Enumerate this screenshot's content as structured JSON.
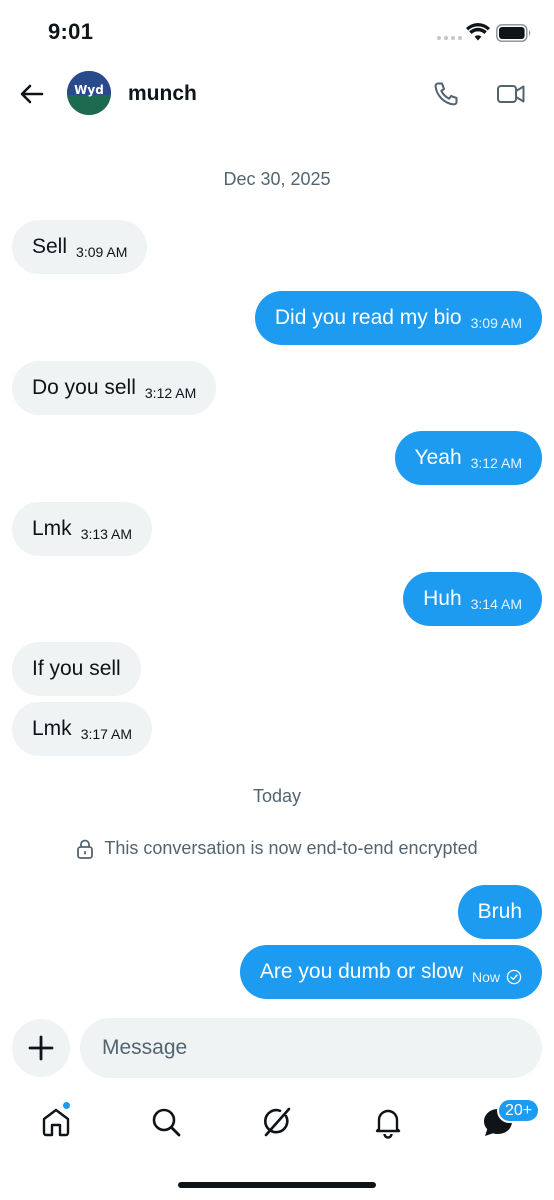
{
  "status_bar": {
    "time": "9:01"
  },
  "header": {
    "contact_name": "munch",
    "avatar_text": "Wyd"
  },
  "conversation": {
    "date_separator_1": "Dec 30, 2025",
    "date_separator_2": "Today",
    "encryption_notice": "This conversation is now end-to-end encrypted",
    "messages": [
      {
        "direction": "in",
        "text": "Sell",
        "time": "3:09 AM"
      },
      {
        "direction": "out",
        "text": "Did you read my bio",
        "time": "3:09 AM"
      },
      {
        "direction": "in",
        "text": "Do you sell",
        "time": "3:12 AM"
      },
      {
        "direction": "out",
        "text": "Yeah",
        "time": "3:12 AM"
      },
      {
        "direction": "in",
        "text": "Lmk",
        "time": "3:13 AM"
      },
      {
        "direction": "out",
        "text": "Huh",
        "time": "3:14 AM"
      },
      {
        "direction": "in",
        "text": "If you sell",
        "time": ""
      },
      {
        "direction": "in",
        "text": "Lmk",
        "time": "3:17 AM"
      },
      {
        "direction": "out",
        "text": "Bruh",
        "time": ""
      },
      {
        "direction": "out",
        "text": "Are you dumb or slow",
        "time": "Now",
        "status": "sent-check-icon"
      }
    ]
  },
  "composer": {
    "placeholder": "Message"
  },
  "bottom_nav": {
    "items": [
      "home-icon",
      "search-icon",
      "grok-icon",
      "notifications-icon",
      "messages-icon"
    ],
    "messages_badge": "20+",
    "home_has_dot": true
  },
  "colors": {
    "accent": "#1d9bf0",
    "incoming_bubble": "#eff3f4",
    "muted_text": "#536471",
    "text": "#0f1419"
  }
}
